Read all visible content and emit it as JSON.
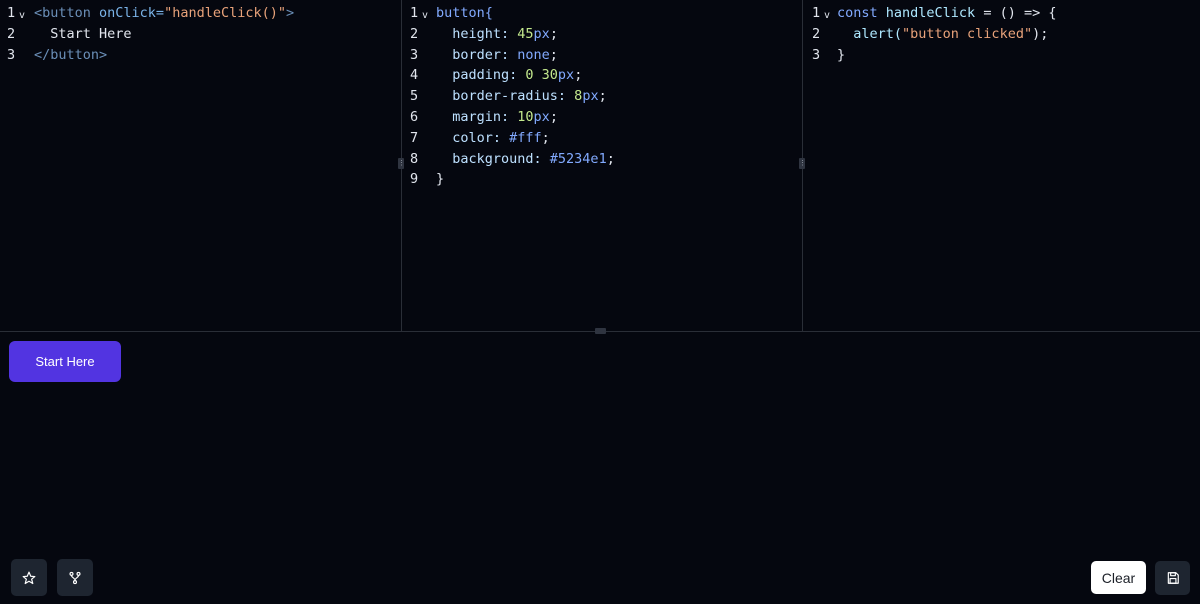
{
  "html_editor": {
    "lines": [
      {
        "n": "1",
        "fold": "v",
        "parts": [
          [
            "tag",
            "<button "
          ],
          [
            "attr",
            "onClick="
          ],
          [
            "str",
            "\"handleClick()\""
          ],
          [
            "tag",
            ">"
          ]
        ]
      },
      {
        "n": "2",
        "fold": "",
        "parts": [
          [
            "plain",
            "  Start Here"
          ]
        ]
      },
      {
        "n": "3",
        "fold": "",
        "parts": [
          [
            "tag",
            "</button>"
          ]
        ]
      }
    ]
  },
  "css_editor": {
    "lines": [
      {
        "n": "1",
        "fold": "v",
        "parts": [
          [
            "sel",
            "button{"
          ]
        ]
      },
      {
        "n": "2",
        "fold": "",
        "parts": [
          [
            "prop",
            "  height: "
          ],
          [
            "num",
            "45"
          ],
          [
            "unit",
            "px"
          ],
          [
            "plain",
            ";"
          ]
        ]
      },
      {
        "n": "3",
        "fold": "",
        "parts": [
          [
            "prop",
            "  border: "
          ],
          [
            "unit",
            "none"
          ],
          [
            "plain",
            ";"
          ]
        ]
      },
      {
        "n": "4",
        "fold": "",
        "parts": [
          [
            "prop",
            "  padding: "
          ],
          [
            "num",
            "0 30"
          ],
          [
            "unit",
            "px"
          ],
          [
            "plain",
            ";"
          ]
        ]
      },
      {
        "n": "5",
        "fold": "",
        "parts": [
          [
            "prop",
            "  border-radius: "
          ],
          [
            "num",
            "8"
          ],
          [
            "unit",
            "px"
          ],
          [
            "plain",
            ";"
          ]
        ]
      },
      {
        "n": "6",
        "fold": "",
        "parts": [
          [
            "prop",
            "  margin: "
          ],
          [
            "num",
            "10"
          ],
          [
            "unit",
            "px"
          ],
          [
            "plain",
            ";"
          ]
        ]
      },
      {
        "n": "7",
        "fold": "",
        "parts": [
          [
            "prop",
            "  color: "
          ],
          [
            "unit",
            "#fff"
          ],
          [
            "plain",
            ";"
          ]
        ]
      },
      {
        "n": "8",
        "fold": "",
        "parts": [
          [
            "prop",
            "  background: "
          ],
          [
            "unit",
            "#5234e1"
          ],
          [
            "plain",
            ";"
          ]
        ]
      },
      {
        "n": "9",
        "fold": "",
        "parts": [
          [
            "plain",
            "}"
          ]
        ]
      }
    ]
  },
  "js_editor": {
    "lines": [
      {
        "n": "1",
        "fold": "v",
        "parts": [
          [
            "kw",
            "const "
          ],
          [
            "fn",
            "handleClick"
          ],
          [
            "plain",
            " = () => {"
          ]
        ]
      },
      {
        "n": "2",
        "fold": "",
        "parts": [
          [
            "fn",
            "  alert("
          ],
          [
            "str",
            "\"button clicked\""
          ],
          [
            "plain",
            ");"
          ]
        ]
      },
      {
        "n": "3",
        "fold": "",
        "parts": [
          [
            "plain",
            "}"
          ]
        ]
      }
    ]
  },
  "preview": {
    "button_label": "Start Here"
  },
  "toolbar": {
    "star_icon": "star-icon",
    "fork_icon": "fork-icon",
    "clear_label": "Clear",
    "save_icon": "save-icon"
  },
  "colors": {
    "background": "#05070f",
    "preview_button": "#5234e1"
  }
}
